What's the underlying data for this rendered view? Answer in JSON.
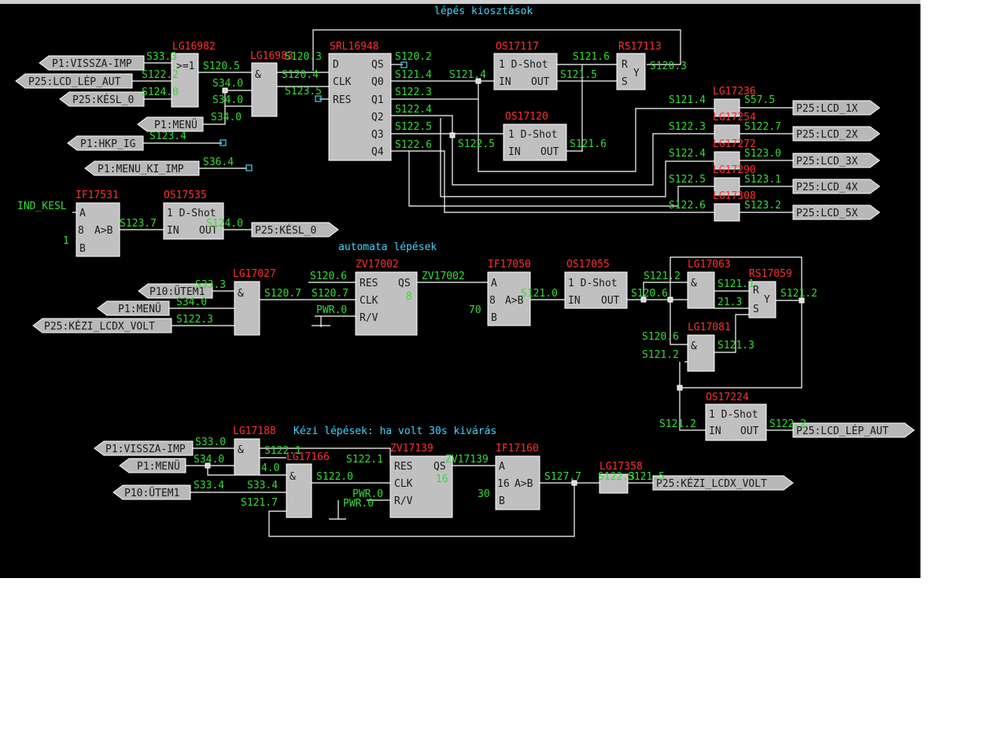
{
  "sections": {
    "lepes": "lépés kiosztások",
    "automata": "automata lépések",
    "kezi": "Kézi lépések: ha volt 30s kivárás"
  },
  "blocks": [
    {
      "id": "LG16982",
      "type": "or",
      "name": "LG16982",
      "sym": ">=1"
    },
    {
      "id": "LG16983",
      "type": "and",
      "name": "LG16983",
      "sym": "&"
    },
    {
      "id": "SRL16948",
      "type": "srl",
      "name": "SRL16948",
      "pins_in": [
        "D",
        "CLK",
        "RES"
      ],
      "pins_out": [
        "QS",
        "Q0",
        "Q1",
        "Q2",
        "Q3",
        "Q4"
      ]
    },
    {
      "id": "OS17117",
      "type": "oneshot",
      "name": "OS17117",
      "title": "1  D-Shot",
      "in": "IN",
      "out": "OUT"
    },
    {
      "id": "RS17113",
      "type": "rs",
      "name": "RS17113",
      "r": "R",
      "s": "S",
      "y": "Y"
    },
    {
      "id": "OS17120",
      "type": "oneshot",
      "name": "OS17120",
      "title": "1  D-Shot",
      "in": "IN",
      "out": "OUT"
    },
    {
      "id": "LG17236",
      "type": "buf",
      "name": "LG17236"
    },
    {
      "id": "LG17254",
      "type": "buf",
      "name": "LG17254"
    },
    {
      "id": "LG17272",
      "type": "buf",
      "name": "LG17272"
    },
    {
      "id": "LG17290",
      "type": "buf",
      "name": "LG17290"
    },
    {
      "id": "LG17308",
      "type": "buf",
      "name": "LG17308"
    },
    {
      "id": "IF17531",
      "type": "cmp",
      "name": "IF17531",
      "a": "A",
      "b": "B",
      "op": "A>B",
      "val": "8"
    },
    {
      "id": "OS17535",
      "type": "oneshot",
      "name": "OS17535",
      "title": "1  D-Shot",
      "in": "IN",
      "out": "OUT"
    },
    {
      "id": "LG17027",
      "type": "and",
      "name": "LG17027",
      "sym": "&"
    },
    {
      "id": "ZV17002",
      "type": "zv",
      "name": "ZV17002",
      "pins": [
        "RES",
        "CLK",
        "R/V"
      ],
      "qs": "QS",
      "val": "8"
    },
    {
      "id": "IF17050",
      "type": "cmp",
      "name": "IF17050",
      "a": "A",
      "b": "B",
      "op": "A>B",
      "val": "8"
    },
    {
      "id": "OS17055",
      "type": "oneshot",
      "name": "OS17055",
      "title": "1  D-Shot",
      "in": "IN",
      "out": "OUT"
    },
    {
      "id": "LG17063",
      "type": "and",
      "name": "LG17063",
      "sym": "&"
    },
    {
      "id": "RS17059",
      "type": "rs",
      "name": "RS17059",
      "r": "R",
      "s": "S",
      "y": "Y"
    },
    {
      "id": "LG17081",
      "type": "and",
      "name": "LG17081",
      "sym": "&"
    },
    {
      "id": "OS17224",
      "type": "oneshot",
      "name": "OS17224",
      "title": "1  D-Shot",
      "in": "IN",
      "out": "OUT"
    },
    {
      "id": "LG17188",
      "type": "and",
      "name": "LG17188",
      "sym": "&"
    },
    {
      "id": "LG17166",
      "type": "and",
      "name": "LG17166",
      "sym": "&"
    },
    {
      "id": "ZV17139",
      "type": "zv",
      "name": "ZV17139",
      "pins": [
        "RES",
        "CLK",
        "R/V"
      ],
      "qs": "QS",
      "val": "16"
    },
    {
      "id": "IF17160",
      "type": "cmp",
      "name": "IF17160",
      "a": "A",
      "b": "B",
      "op": "A>B",
      "val": "16"
    },
    {
      "id": "LG17358",
      "type": "buf",
      "name": "LG17358"
    }
  ],
  "tags": [
    "P1:VISSZA-IMP",
    "P25:LCD_LÉP_AUT",
    "P25:KÉSL_0",
    "P1:MENÜ",
    "P1:HKP_IG",
    "P1:MENU_KI_IMP",
    "P25:LCD_1X",
    "P25:LCD_2X",
    "P25:LCD_3X",
    "P25:LCD_4X",
    "P25:LCD_5X",
    "P25:KÉSL_0",
    "P10:ÜTEM1",
    "P1:MENÜ",
    "P25:KÉZI_LCDX_VOLT",
    "P25:LCD_LÉP_AUT",
    "P1:VISSZA-IMP",
    "P1:MENÜ",
    "P10:ÜTEM1",
    "P25:KÉZI_LCDX_VOLT"
  ],
  "signals": [
    "S33.3",
    "S122.2",
    "S124.0",
    "S120.5",
    "S120.4",
    "S34.0",
    "S34.0",
    "S34.0",
    "S123.4",
    "S36.4",
    "S120.3",
    "S123.5",
    "S120.2",
    "S121.4",
    "S122.3",
    "S122.4",
    "S122.5",
    "S122.6",
    "S121.4",
    "S121.6",
    "S120.3",
    "S121.5",
    "S122.5",
    "S121.6",
    "S121.4",
    "S122.3",
    "S122.4",
    "S122.5",
    "S122.6",
    "S57.5",
    "S122.7",
    "S123.0",
    "S123.1",
    "S123.2",
    "IND_KESL",
    "1",
    "S123.7",
    "S124.0",
    "S33.3",
    "S34.0",
    "S122.3",
    "S120.7",
    "S120.7",
    "S120.6",
    "ZV17002",
    "PWR.0",
    "70",
    "S121.0",
    "S120.6",
    "S121.2",
    "S121.1",
    "21.3",
    "S121.2",
    "S120.6",
    "S121.2",
    "S121.3",
    "S121.2",
    "S122.2",
    "S33.0",
    "S34.0",
    "S33.4",
    "S122.1",
    "S33.4",
    "4.0",
    "S121.7",
    "S122.0",
    "S122.1",
    "ZV17139",
    "PWR.0",
    "PWR.0",
    "30",
    "S127.7",
    "S121.5",
    "S122.3"
  ],
  "pwr": "PWR.0",
  "const_8": "8",
  "const_70": "70",
  "const_30": "30",
  "const_1": "1",
  "ind_kesl": "IND_KESL"
}
